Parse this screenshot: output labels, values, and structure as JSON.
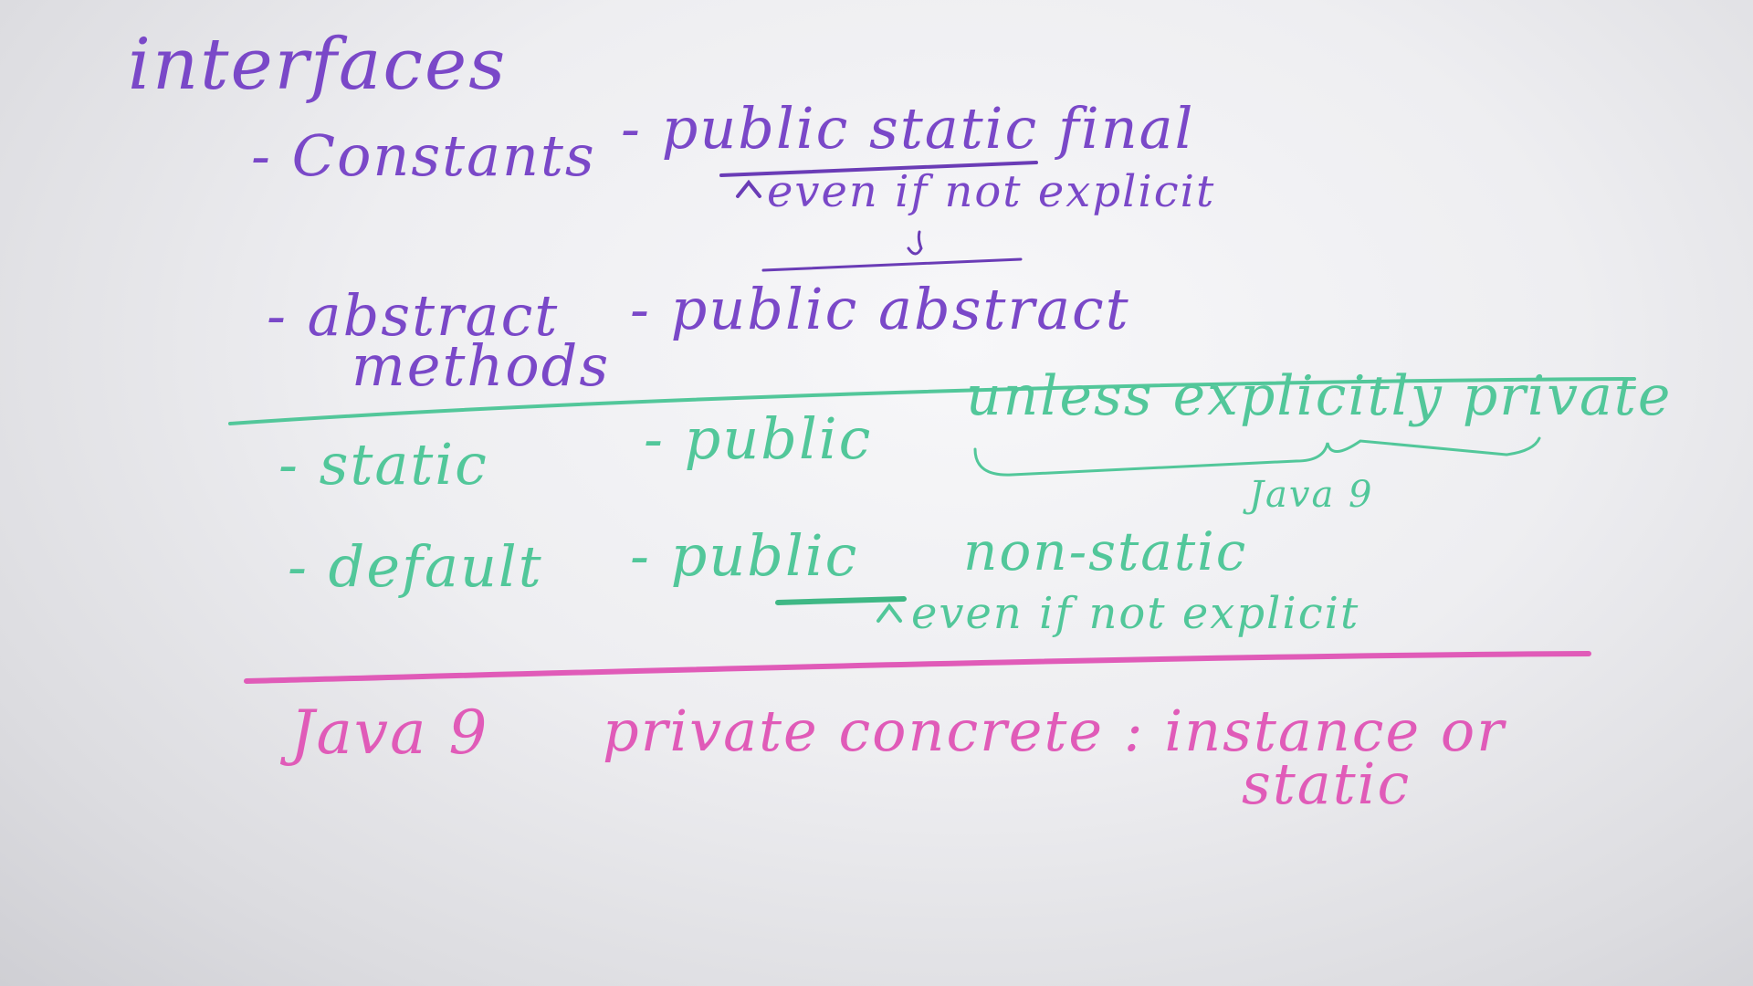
{
  "board": {
    "title": "interfaces",
    "rows": [
      {
        "item": "- Constants",
        "rule": "- public static final",
        "note": "even if not explicit"
      },
      {
        "item_line1": "- abstract",
        "item_line2": "methods",
        "rule": "- public abstract"
      },
      {
        "item": "- static",
        "rule": "- public",
        "note": "unless explicitly private",
        "brace_note": "Java 9"
      },
      {
        "item": "- default",
        "rule": "- public",
        "extra": "non-static",
        "note": "even if not explicit"
      }
    ],
    "footer": {
      "label": "Java 9",
      "text": "private concrete : instance or",
      "text2": "static"
    }
  },
  "colors": {
    "purple": "#7a48c8",
    "green": "#52c79a",
    "pink": "#e05bb8"
  }
}
